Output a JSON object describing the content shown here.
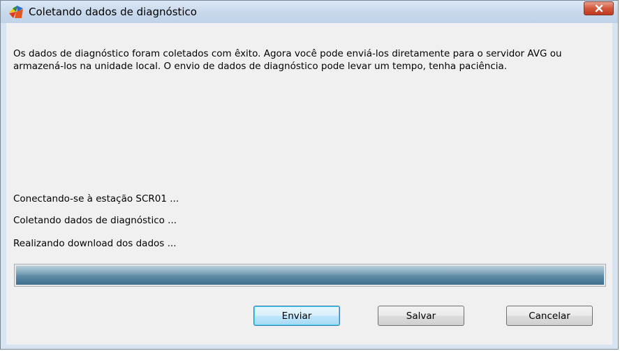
{
  "window": {
    "title": "Coletando dados de diagnóstico",
    "icon": "avg-logo-icon"
  },
  "message": "Os dados de diagnóstico foram coletados com êxito. Agora você pode enviá-los diretamente para o servidor AVG ou armazená-los na unidade local. O envio de dados de diagnóstico pode levar um tempo, tenha paciência.",
  "status_lines": [
    "Conectando-se à estação SCR01 ...",
    "Coletando dados de diagnóstico ...",
    "Realizando download dos dados ..."
  ],
  "progress": {
    "percent": 100,
    "fill_color": "#4a7a98"
  },
  "buttons": {
    "send": "Enviar",
    "save": "Salvar",
    "cancel": "Cancelar"
  },
  "colors": {
    "close_button": "#c7452b",
    "frame": "#d8e4f2"
  }
}
